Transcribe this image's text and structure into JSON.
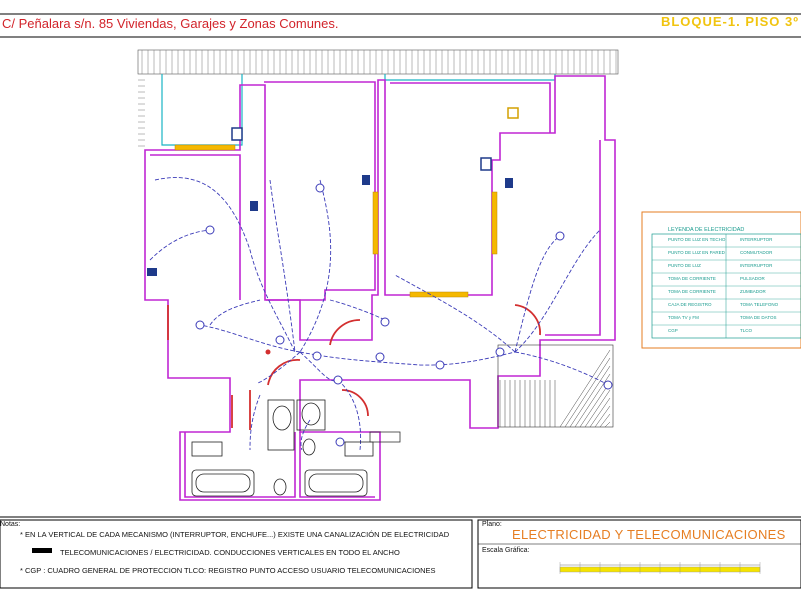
{
  "header": {
    "project": "C/ Peñalara s/n. 85 Viviendas, Garajes y Zonas Comunes.",
    "block": "BLOQUE-1. PISO 3º"
  },
  "notes": {
    "label": "Notas:",
    "lines": [
      "* EN LA VERTICAL DE CADA MECANISMO (INTERRUPTOR, ENCHUFE...) EXISTE UNA CANALIZACIÓN DE ELECTRICIDAD",
      "TELECOMUNICACIONES /  ELECTRICIDAD.     CONDUCCIONES VERTICALES EN TODO EL ANCHO",
      "* CGP : CUADRO GENERAL DE PROTECCION     TLCO: REGISTRO PUNTO ACCESO USUARIO TELECOMUNICACIONES"
    ]
  },
  "plano": {
    "label": "Plano:",
    "title": "ELECTRICIDAD Y TELECOMUNICACIONES",
    "scale_label": "Escala Gráfica:"
  },
  "legend": {
    "title": "LEYENDA DE ELECTRICIDAD",
    "items": [
      "PUNTO DE LUZ EN TECHO",
      "INTERRUPTOR",
      "PUNTO DE LUZ EN PARED",
      "CONMUTADOR",
      "PUNTO DE LUZ",
      "INTERRUPTOR",
      "TOMA DE CORRIENTE",
      "PULSADOR",
      "TOMA DE CORRIENTE",
      "ZUMBADOR",
      "CAJA DE REGISTRO",
      "TOMA TELEFONO",
      "TOMA TV y FM",
      "TOMA DE DATOS",
      "CGP",
      "TLCO"
    ]
  },
  "colors": {
    "wall": "#c026d3",
    "line": "#3b3bb8",
    "door": "#d32f2f",
    "window": "#f5b800",
    "title": "#d2232a",
    "legend": "#1a9c8f"
  }
}
